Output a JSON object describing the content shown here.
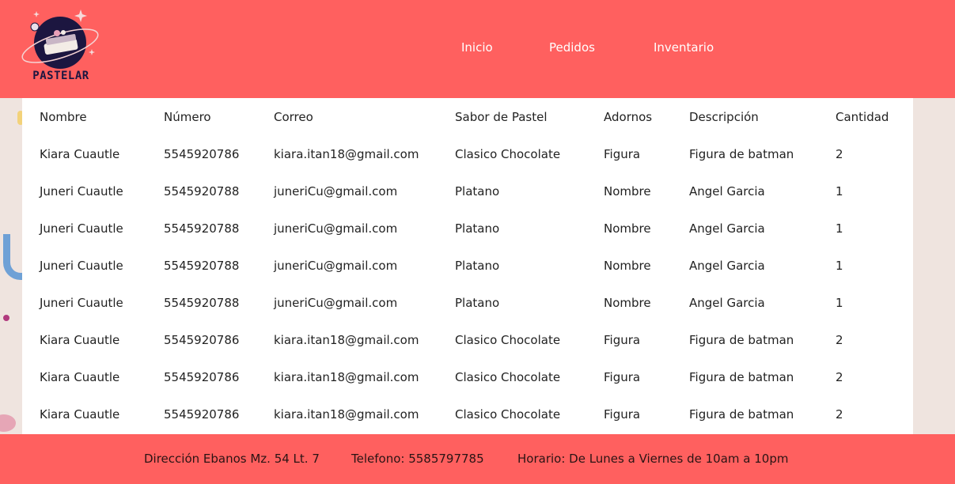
{
  "brand": {
    "name": "PASTELAR"
  },
  "nav": {
    "items": [
      "Inicio",
      "Pedidos",
      "Inventario"
    ]
  },
  "table": {
    "columns": [
      "Nombre",
      "Número",
      "Correo",
      "Sabor de Pastel",
      "Adornos",
      "Descripción",
      "Cantidad"
    ],
    "rows": [
      [
        "Kiara Cuautle",
        "5545920786",
        "kiara.itan18@gmail.com",
        "Clasico Chocolate",
        "Figura",
        "Figura de batman",
        "2"
      ],
      [
        "Juneri Cuautle",
        "5545920788",
        "juneriCu@gmail.com",
        "Platano",
        "Nombre",
        "Angel Garcia",
        "1"
      ],
      [
        "Juneri Cuautle",
        "5545920788",
        "juneriCu@gmail.com",
        "Platano",
        "Nombre",
        "Angel Garcia",
        "1"
      ],
      [
        "Juneri Cuautle",
        "5545920788",
        "juneriCu@gmail.com",
        "Platano",
        "Nombre",
        "Angel Garcia",
        "1"
      ],
      [
        "Juneri Cuautle",
        "5545920788",
        "juneriCu@gmail.com",
        "Platano",
        "Nombre",
        "Angel Garcia",
        "1"
      ],
      [
        "Kiara Cuautle",
        "5545920786",
        "kiara.itan18@gmail.com",
        "Clasico Chocolate",
        "Figura",
        "Figura de batman",
        "2"
      ],
      [
        "Kiara Cuautle",
        "5545920786",
        "kiara.itan18@gmail.com",
        "Clasico Chocolate",
        "Figura",
        "Figura de batman",
        "2"
      ],
      [
        "Kiara Cuautle",
        "5545920786",
        "kiara.itan18@gmail.com",
        "Clasico Chocolate",
        "Figura",
        "Figura de batman",
        "2"
      ]
    ]
  },
  "footer": {
    "address": "Dirección Ebanos Mz. 54 Lt. 7",
    "phone": "Telefono: 5585797785",
    "hours": "Horario: De Lunes a Viernes de 10am a 10pm"
  },
  "colors": {
    "accent": "#ff605f",
    "background": "#efe4df",
    "logo_navy": "#1c1640"
  }
}
